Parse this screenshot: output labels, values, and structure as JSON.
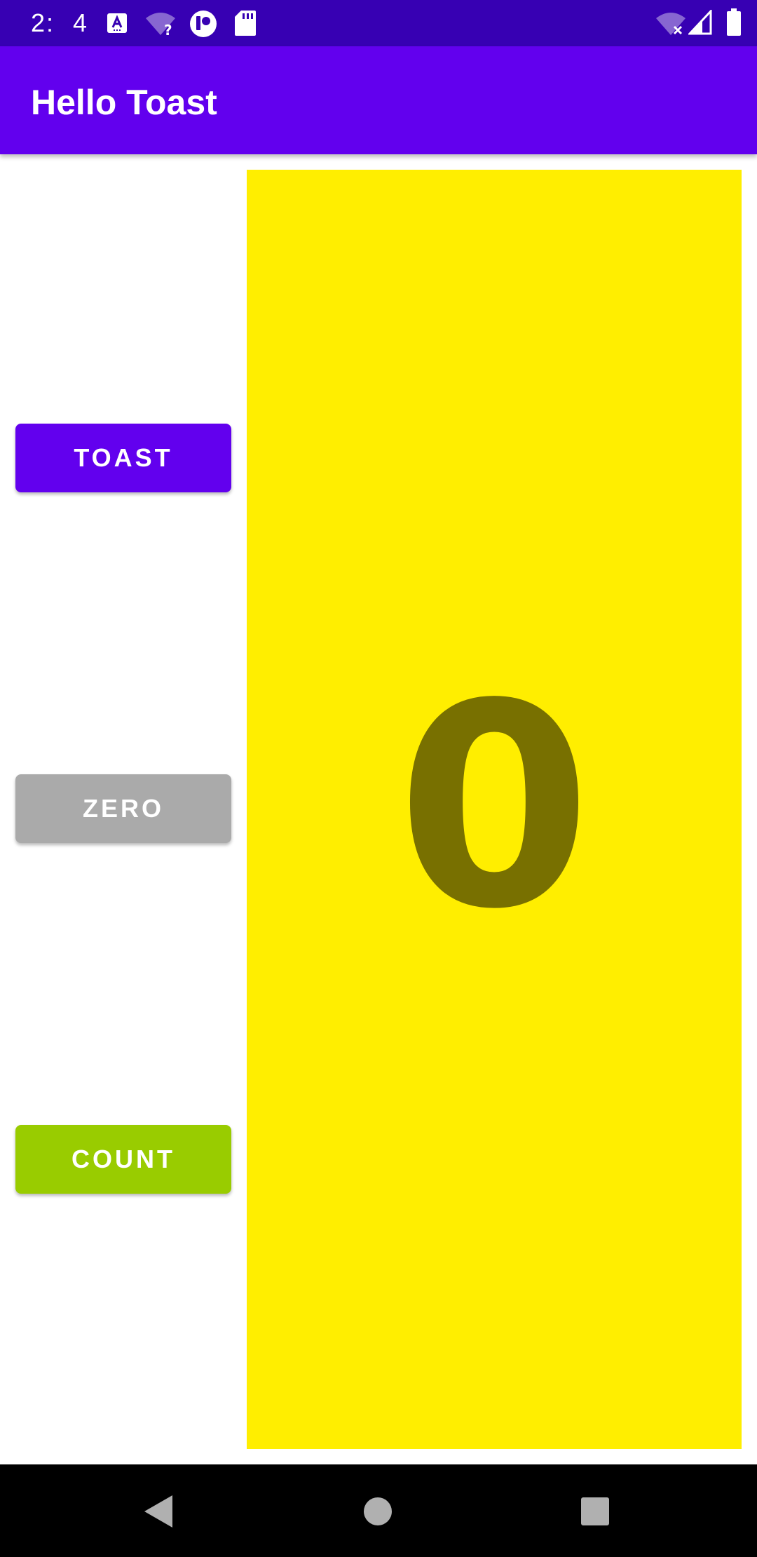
{
  "status_bar": {
    "time": "2: 4",
    "icons": [
      "a-notification-icon",
      "wifi-question-icon",
      "circle-app-icon",
      "sd-card-icon",
      "wifi-x-icon",
      "signal-icon",
      "battery-icon"
    ]
  },
  "app_bar": {
    "title": "Hello Toast"
  },
  "buttons": {
    "toast_label": "TOAST",
    "zero_label": "ZERO",
    "count_label": "COUNT"
  },
  "count_display": {
    "value": "0"
  },
  "nav_bar": {
    "icons": [
      "back-icon",
      "home-icon",
      "recents-icon"
    ]
  },
  "colors": {
    "status_bar": "#3700b3",
    "app_bar": "#6200ee",
    "toast_button": "#6200ee",
    "zero_button": "#aaaaaa",
    "count_button": "#99cc00",
    "count_panel": "#ffee00",
    "count_text": "#787000",
    "nav_bar": "#000000"
  }
}
